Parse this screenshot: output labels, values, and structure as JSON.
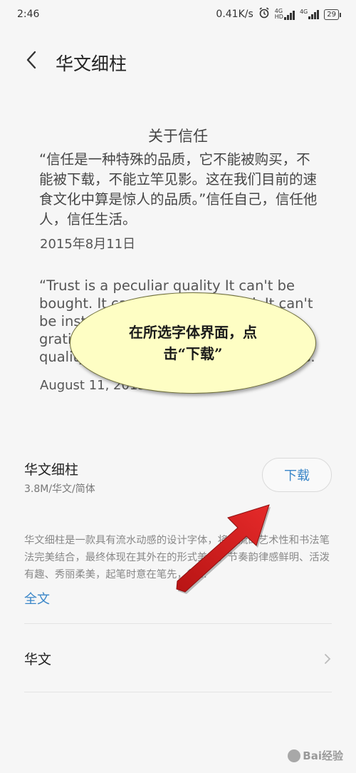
{
  "status_bar": {
    "time": "2:46",
    "speed": "0.41K/s",
    "hd": "HD",
    "net1": "4G",
    "net2": "4G",
    "battery": "29"
  },
  "header": {
    "title": "华文细柱"
  },
  "preview": {
    "title": "关于信任",
    "cn_text": "“信任是一种特殊的品质，它不能被购买，不能被下载，不能立竿见影。这在我们目前的速食文化中算是惊人的品质。”信任自己，信任他人，信任生活。",
    "date_cn": "2015年8月11日",
    "en_text": "“Trust is a peculiar quality It can't be bought. It can't be downloaded. It can't be instant — which in our instant-gratification culture is a remarkable quality.” Trust yourself and trust others.",
    "date_en": "August 11, 2015"
  },
  "callout": {
    "text": "在所选字体界面，点击“下载”"
  },
  "font": {
    "name": "华文细柱",
    "meta": "3.8M/华文/简体",
    "download_label": "下载",
    "description": "华文细柱是一款具有流水动感的设计字体，将水流的艺术性和书法笔法完美结合，最终体现在其外在的形式美中。节奏韵律感鲜明、活泼有趣、秀丽柔美，起笔时意在笔先，行...",
    "fulltext_label": "全文"
  },
  "category": {
    "label": "华文"
  },
  "watermark": {
    "text": "Bai经验"
  },
  "colors": {
    "accent": "#3a86c8",
    "callout_fill": "#fefec4",
    "arrow": "#d81e1e"
  }
}
